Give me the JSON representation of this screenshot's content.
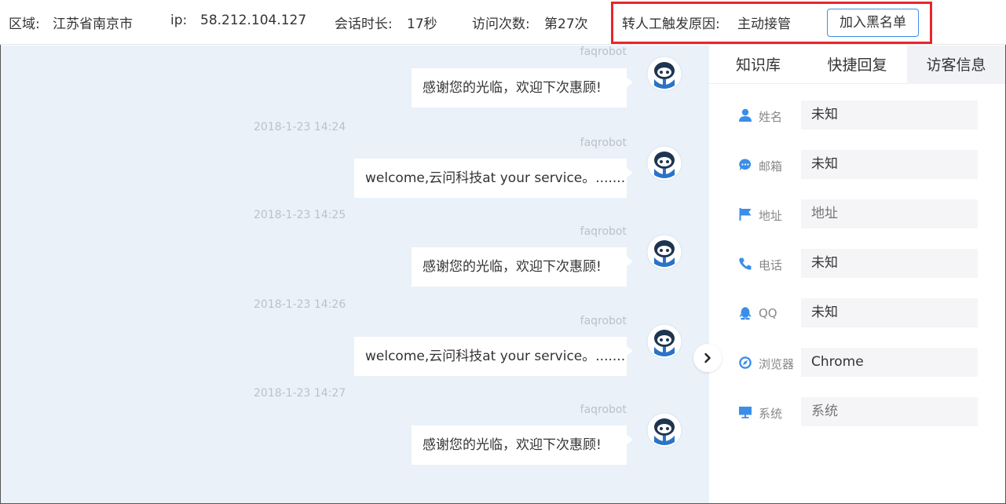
{
  "header": {
    "region_label": "区域:",
    "region_value": "江苏省南京市",
    "ip_label": "ip:",
    "ip_value": "58.212.104.127",
    "duration_label": "会话时长:",
    "duration_value": "17秒",
    "visits_label": "访问次数:",
    "visits_value": "第27次",
    "transfer_label": "转人工触发原因:",
    "transfer_value": "主动接管",
    "blacklist_button": "加入黑名单"
  },
  "messages": [
    {
      "time": "",
      "sender": "faqrobot",
      "text": "感谢您的光临，欢迎下次惠顾!"
    },
    {
      "time": "2018-1-23 14:24",
      "sender": "faqrobot",
      "text": "welcome,云问科技at your service。......."
    },
    {
      "time": "2018-1-23 14:25",
      "sender": "faqrobot",
      "text": "感谢您的光临，欢迎下次惠顾!"
    },
    {
      "time": "2018-1-23 14:26",
      "sender": "faqrobot",
      "text": "welcome,云问科技at your service。......."
    },
    {
      "time": "2018-1-23 14:27",
      "sender": "faqrobot",
      "text": "感谢您的光临，欢迎下次惠顾!"
    }
  ],
  "panel": {
    "tabs": [
      {
        "label": "知识库",
        "active": false
      },
      {
        "label": "快捷回复",
        "active": false
      },
      {
        "label": "访客信息",
        "active": true
      }
    ],
    "fields": [
      {
        "icon": "user-icon",
        "label": "姓名",
        "value": "未知",
        "placeholder": ""
      },
      {
        "icon": "email-icon",
        "label": "邮箱",
        "value": "未知",
        "placeholder": ""
      },
      {
        "icon": "flag-icon",
        "label": "地址",
        "value": "",
        "placeholder": "地址"
      },
      {
        "icon": "phone-icon",
        "label": "电话",
        "value": "未知",
        "placeholder": ""
      },
      {
        "icon": "qq-icon",
        "label": "QQ",
        "value": "未知",
        "placeholder": ""
      },
      {
        "icon": "browser-icon",
        "label": "浏览器",
        "value": "Chrome",
        "placeholder": ""
      },
      {
        "icon": "monitor-icon",
        "label": "系统",
        "value": "",
        "placeholder": "系统"
      }
    ]
  },
  "colors": {
    "accent": "#3b8ee8",
    "highlight_border": "#e8262d",
    "chat_bg": "#eaf1f9",
    "meta_text": "#b9c2cc"
  }
}
